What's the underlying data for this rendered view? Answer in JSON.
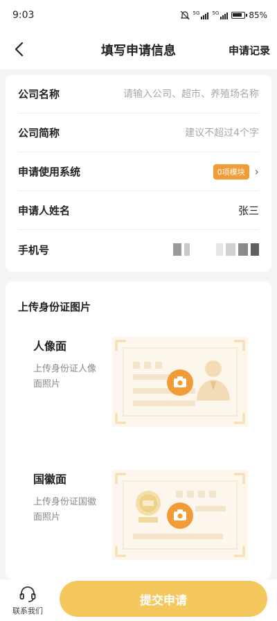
{
  "status": {
    "time": "9:03",
    "battery": "85%",
    "network": "5G"
  },
  "nav": {
    "title": "填写申请信息",
    "action": "申请记录"
  },
  "form": {
    "company_name": {
      "label": "公司名称",
      "placeholder": "请输入公司、超市、养殖场名称"
    },
    "company_short": {
      "label": "公司简称",
      "placeholder": "建议不超过4个字"
    },
    "system": {
      "label": "申请使用系统",
      "badge": "0项模块"
    },
    "applicant": {
      "label": "申请人姓名",
      "value": "张三"
    },
    "phone": {
      "label": "手机号"
    }
  },
  "upload": {
    "title": "上传身份证图片",
    "front": {
      "name": "人像面",
      "desc": "上传身份证人像面照片"
    },
    "back": {
      "name": "国徽面",
      "desc": "上传身份证国徽面照片"
    }
  },
  "bottom": {
    "contact": "联系我们",
    "submit": "提交申请"
  },
  "colors": {
    "accent": "#f29c38",
    "submit": "#f5c75f",
    "frame": "#fdf6ec"
  }
}
